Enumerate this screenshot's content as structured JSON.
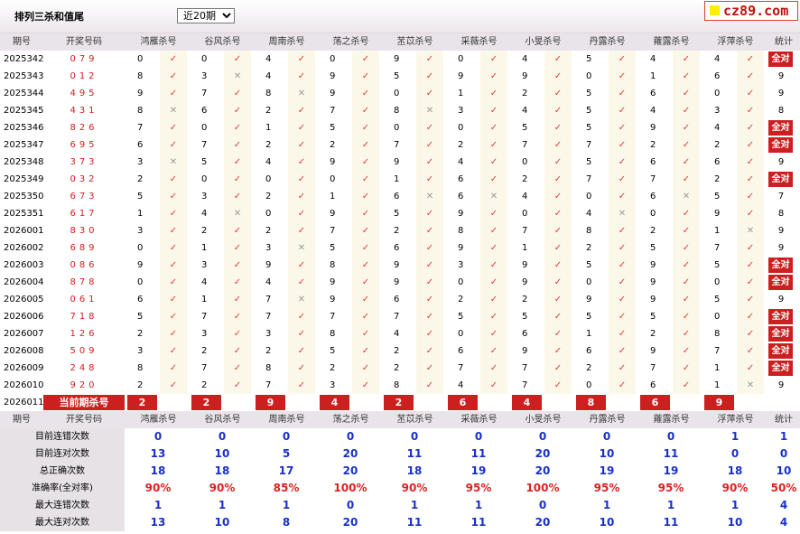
{
  "title": "排列三杀和值尾",
  "range_select": {
    "selected": "近20期"
  },
  "logo": "cz89.com",
  "headers": [
    "期号",
    "开奖号码",
    "鸿雁杀号",
    "谷风杀号",
    "周南杀号",
    "荡之杀号",
    "苤苡杀号",
    "采薇杀号",
    "小旻杀号",
    "丹露杀号",
    "蕹露杀号",
    "浮萍杀号",
    "统计"
  ],
  "rows": [
    {
      "period": "2025342",
      "draw": "079",
      "kills": [
        0,
        0,
        4,
        0,
        9,
        0,
        4,
        5,
        4,
        4
      ],
      "marks": [
        "t",
        "t",
        "t",
        "t",
        "t",
        "t",
        "t",
        "t",
        "t",
        "t"
      ],
      "stat": "全对"
    },
    {
      "period": "2025343",
      "draw": "012",
      "kills": [
        8,
        3,
        4,
        9,
        5,
        9,
        9,
        0,
        1,
        6
      ],
      "marks": [
        "t",
        "x",
        "t",
        "t",
        "t",
        "t",
        "t",
        "t",
        "t",
        "t"
      ],
      "stat": "9"
    },
    {
      "period": "2025344",
      "draw": "495",
      "kills": [
        9,
        7,
        8,
        9,
        0,
        1,
        2,
        5,
        6,
        0
      ],
      "marks": [
        "t",
        "t",
        "x",
        "t",
        "t",
        "t",
        "t",
        "t",
        "t",
        "t"
      ],
      "stat": "9"
    },
    {
      "period": "2025345",
      "draw": "431",
      "kills": [
        8,
        6,
        2,
        7,
        8,
        3,
        4,
        5,
        4,
        3
      ],
      "marks": [
        "x",
        "t",
        "t",
        "t",
        "x",
        "t",
        "t",
        "t",
        "t",
        "t"
      ],
      "stat": "8"
    },
    {
      "period": "2025346",
      "draw": "826",
      "kills": [
        7,
        0,
        1,
        5,
        0,
        0,
        5,
        5,
        9,
        4
      ],
      "marks": [
        "t",
        "t",
        "t",
        "t",
        "t",
        "t",
        "t",
        "t",
        "t",
        "t"
      ],
      "stat": "全对"
    },
    {
      "period": "2025347",
      "draw": "695",
      "kills": [
        6,
        7,
        2,
        2,
        7,
        2,
        7,
        7,
        2,
        2
      ],
      "marks": [
        "t",
        "t",
        "t",
        "t",
        "t",
        "t",
        "t",
        "t",
        "t",
        "t"
      ],
      "stat": "全对"
    },
    {
      "period": "2025348",
      "draw": "373",
      "kills": [
        3,
        5,
        4,
        9,
        9,
        4,
        0,
        5,
        6,
        6
      ],
      "marks": [
        "x",
        "t",
        "t",
        "t",
        "t",
        "t",
        "t",
        "t",
        "t",
        "t"
      ],
      "stat": "9"
    },
    {
      "period": "2025349",
      "draw": "032",
      "kills": [
        2,
        0,
        0,
        0,
        1,
        6,
        2,
        7,
        7,
        2
      ],
      "marks": [
        "t",
        "t",
        "t",
        "t",
        "t",
        "t",
        "t",
        "t",
        "t",
        "t"
      ],
      "stat": "全对"
    },
    {
      "period": "2025350",
      "draw": "673",
      "kills": [
        5,
        3,
        2,
        1,
        6,
        6,
        4,
        0,
        6,
        5
      ],
      "marks": [
        "t",
        "t",
        "t",
        "t",
        "x",
        "x",
        "t",
        "t",
        "x",
        "t"
      ],
      "stat": "7"
    },
    {
      "period": "2025351",
      "draw": "617",
      "kills": [
        1,
        4,
        0,
        9,
        5,
        9,
        0,
        4,
        0,
        9
      ],
      "marks": [
        "t",
        "x",
        "t",
        "t",
        "t",
        "t",
        "t",
        "x",
        "t",
        "t"
      ],
      "stat": "8"
    },
    {
      "period": "2026001",
      "draw": "830",
      "kills": [
        3,
        2,
        2,
        7,
        2,
        8,
        7,
        8,
        2,
        1
      ],
      "marks": [
        "t",
        "t",
        "t",
        "t",
        "t",
        "t",
        "t",
        "t",
        "t",
        "x"
      ],
      "stat": "9"
    },
    {
      "period": "2026002",
      "draw": "689",
      "kills": [
        0,
        1,
        3,
        5,
        6,
        9,
        1,
        2,
        5,
        7
      ],
      "marks": [
        "t",
        "t",
        "x",
        "t",
        "t",
        "t",
        "t",
        "t",
        "t",
        "t"
      ],
      "stat": "9"
    },
    {
      "period": "2026003",
      "draw": "086",
      "kills": [
        9,
        3,
        9,
        8,
        9,
        3,
        9,
        5,
        9,
        5
      ],
      "marks": [
        "t",
        "t",
        "t",
        "t",
        "t",
        "t",
        "t",
        "t",
        "t",
        "t"
      ],
      "stat": "全对"
    },
    {
      "period": "2026004",
      "draw": "878",
      "kills": [
        0,
        4,
        4,
        9,
        9,
        0,
        9,
        0,
        9,
        0
      ],
      "marks": [
        "t",
        "t",
        "t",
        "t",
        "t",
        "t",
        "t",
        "t",
        "t",
        "t"
      ],
      "stat": "全对"
    },
    {
      "period": "2026005",
      "draw": "061",
      "kills": [
        6,
        1,
        7,
        9,
        6,
        2,
        2,
        9,
        9,
        5
      ],
      "marks": [
        "t",
        "t",
        "x",
        "t",
        "t",
        "t",
        "t",
        "t",
        "t",
        "t"
      ],
      "stat": "9"
    },
    {
      "period": "2026006",
      "draw": "718",
      "kills": [
        5,
        7,
        7,
        7,
        7,
        5,
        5,
        5,
        5,
        0
      ],
      "marks": [
        "t",
        "t",
        "t",
        "t",
        "t",
        "t",
        "t",
        "t",
        "t",
        "t"
      ],
      "stat": "全对"
    },
    {
      "period": "2026007",
      "draw": "126",
      "kills": [
        2,
        3,
        3,
        8,
        4,
        0,
        6,
        1,
        2,
        8
      ],
      "marks": [
        "t",
        "t",
        "t",
        "t",
        "t",
        "t",
        "t",
        "t",
        "t",
        "t"
      ],
      "stat": "全对"
    },
    {
      "period": "2026008",
      "draw": "509",
      "kills": [
        3,
        2,
        2,
        5,
        2,
        6,
        9,
        6,
        9,
        7
      ],
      "marks": [
        "t",
        "t",
        "t",
        "t",
        "t",
        "t",
        "t",
        "t",
        "t",
        "t"
      ],
      "stat": "全对"
    },
    {
      "period": "2026009",
      "draw": "248",
      "kills": [
        8,
        7,
        8,
        2,
        2,
        7,
        7,
        2,
        7,
        1
      ],
      "marks": [
        "t",
        "t",
        "t",
        "t",
        "t",
        "t",
        "t",
        "t",
        "t",
        "t"
      ],
      "stat": "全对"
    },
    {
      "period": "2026010",
      "draw": "920",
      "kills": [
        2,
        2,
        7,
        3,
        8,
        4,
        7,
        0,
        6,
        1
      ],
      "marks": [
        "t",
        "t",
        "t",
        "t",
        "t",
        "t",
        "t",
        "t",
        "t",
        "x"
      ],
      "stat": "9"
    }
  ],
  "current": {
    "period": "2026011",
    "label": "当前期杀号",
    "kills": [
      2,
      2,
      9,
      4,
      2,
      6,
      4,
      8,
      6,
      9
    ]
  },
  "summary_headers": [
    "期号",
    "开奖号码",
    "鸿雁杀号",
    "谷风杀号",
    "周南杀号",
    "荡之杀号",
    "苤苡杀号",
    "采薇杀号",
    "小旻杀号",
    "丹露杀号",
    "蕹露杀号",
    "浮萍杀号",
    "统计"
  ],
  "summary": [
    {
      "label": "目前连错次数",
      "values": [
        "0",
        "0",
        "0",
        "0",
        "0",
        "0",
        "0",
        "0",
        "0",
        "1",
        "1"
      ],
      "color": "blue"
    },
    {
      "label": "目前连对次数",
      "values": [
        "13",
        "10",
        "5",
        "20",
        "11",
        "11",
        "20",
        "10",
        "11",
        "0",
        "0"
      ],
      "color": "blue"
    },
    {
      "label": "总正确次数",
      "values": [
        "18",
        "18",
        "17",
        "20",
        "18",
        "19",
        "20",
        "19",
        "19",
        "18",
        "10"
      ],
      "color": "blue"
    },
    {
      "label": "准确率(全对率)",
      "values": [
        "90%",
        "90%",
        "85%",
        "100%",
        "90%",
        "95%",
        "100%",
        "95%",
        "95%",
        "90%",
        "50%"
      ],
      "color": "red"
    },
    {
      "label": "最大连错次数",
      "values": [
        "1",
        "1",
        "1",
        "0",
        "1",
        "1",
        "0",
        "1",
        "1",
        "1",
        "4"
      ],
      "color": "blue"
    },
    {
      "label": "最大连对次数",
      "values": [
        "13",
        "10",
        "8",
        "20",
        "11",
        "11",
        "20",
        "10",
        "11",
        "10",
        "4"
      ],
      "color": "blue"
    }
  ],
  "icons": {
    "correct": "check-icon",
    "wrong": "cross-icon"
  },
  "colors": {
    "red": "#cc2020",
    "blue": "#1830c8",
    "header_bg": "#e9e4e9"
  }
}
